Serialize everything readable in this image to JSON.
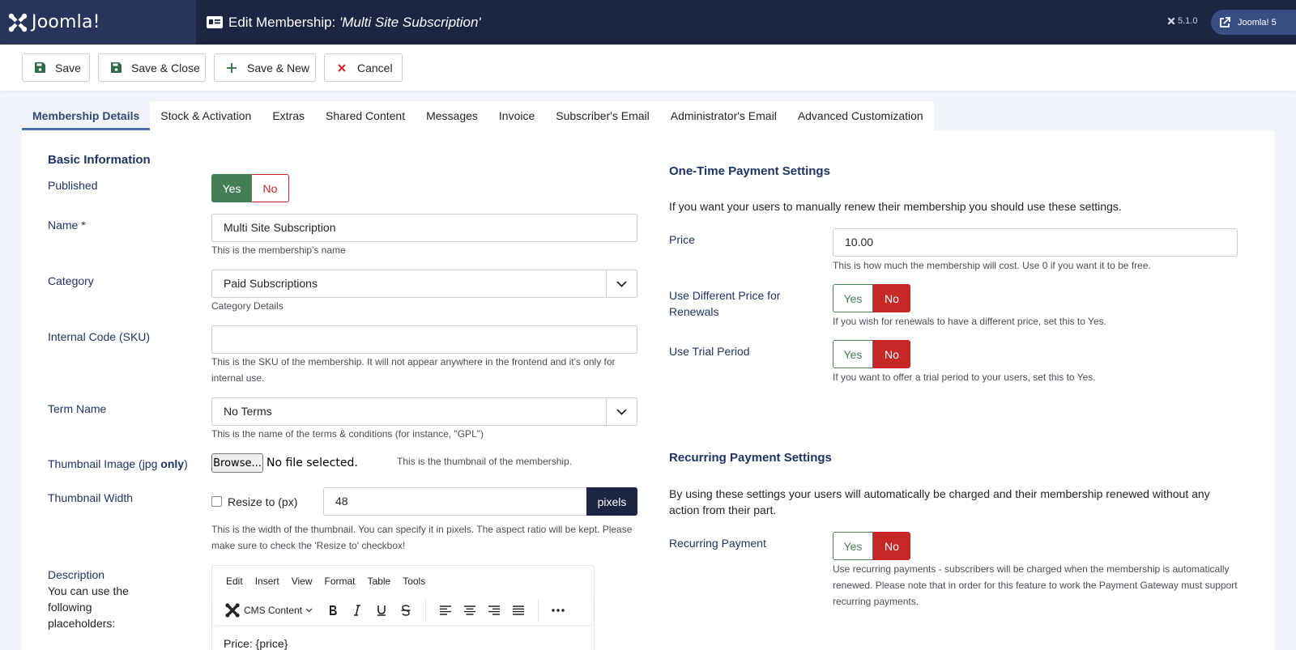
{
  "header": {
    "logo_text": "Joomla!",
    "title_prefix": "Edit Membership: ",
    "title_item": "'Multi Site Subscription'",
    "version": "5.1.0",
    "site_button": "Joomla! 5"
  },
  "toolbar": {
    "save": "Save",
    "save_close": "Save & Close",
    "save_new": "Save & New",
    "cancel": "Cancel"
  },
  "tabs": [
    "Membership Details",
    "Stock & Activation",
    "Extras",
    "Shared Content",
    "Messages",
    "Invoice",
    "Subscriber's Email",
    "Administrator's Email",
    "Advanced Customization"
  ],
  "basic": {
    "section_title": "Basic Information",
    "published_label": "Published",
    "yes": "Yes",
    "no": "No",
    "name_label": "Name *",
    "name_value": "Multi Site Subscription",
    "name_help": "This is the membership's name",
    "category_label": "Category",
    "category_value": "Paid Subscriptions",
    "category_help": "Category Details",
    "sku_label": "Internal Code (SKU)",
    "sku_value": "",
    "sku_help": "This is the SKU of the membership. It will not appear anywhere in the frontend and it's only for internal use.",
    "term_label": "Term Name",
    "term_value": "No Terms",
    "term_help": "This is the name of the terms & conditions (for instance, \"GPL\")",
    "thumb_label_a": "Thumbnail Image (jpg ",
    "thumb_label_b": "only",
    "thumb_label_c": ")",
    "browse": "Browse...",
    "no_file": "No file selected.",
    "thumb_help": "This is the thumbnail of the membership.",
    "width_label": "Thumbnail Width",
    "resize_label": "Resize to (px)",
    "width_value": "48",
    "width_unit": "pixels",
    "width_help": "This is the width of the thumbnail. You can specify it in pixels. The aspect ratio will be kept. Please make sure to check the 'Resize to' checkbox!",
    "desc_label": "Description",
    "desc_sub": "You can use the following placeholders:"
  },
  "editor": {
    "menu": [
      "Edit",
      "Insert",
      "View",
      "Format",
      "Table",
      "Tools"
    ],
    "cms_content": "CMS Content",
    "content": "Price: {price}"
  },
  "one_time": {
    "section_title": "One-Time Payment Settings",
    "intro": "If you want your users to manually renew their membership you should use these settings.",
    "price_label": "Price",
    "price_value": "10.00",
    "price_help": "This is how much the membership will cost. Use 0 if you want it to be free.",
    "diff_label": "Use Different Price for Renewals",
    "diff_help": "If you wish for renewals to have a different price, set this to Yes.",
    "trial_label": "Use Trial Period",
    "trial_help": "If you want to offer a trial period to your users, set this to Yes."
  },
  "recurring": {
    "section_title": "Recurring Payment Settings",
    "intro": "By using these settings your users will automatically be charged and their membership renewed without any action from their part.",
    "label": "Recurring Payment",
    "help": "Use recurring payments - subscribers will be charged when the membership is automatically renewed. Please note that in order for this feature to work the Payment Gateway must support recurring payments."
  }
}
